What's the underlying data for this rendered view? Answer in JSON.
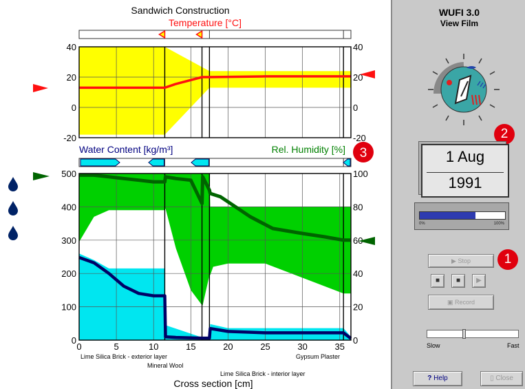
{
  "top_chart": {
    "title": "Sandwich Construction",
    "subtitle": "Temperature [°C]",
    "ylim": [
      -20,
      40
    ],
    "yticks": [
      "40",
      "20",
      "0",
      "-20"
    ],
    "right_yticks": [
      "40",
      "20",
      "0",
      "-20"
    ]
  },
  "bottom_chart": {
    "left_label": "Water Content [kg/m³]",
    "right_label": "Rel. Humidity [%]",
    "yticks_left": [
      "500",
      "400",
      "300",
      "200",
      "100",
      "0"
    ],
    "yticks_right": [
      "100",
      "80",
      "60",
      "40",
      "20",
      "0"
    ],
    "xticks": [
      "0",
      "5",
      "10",
      "15",
      "20",
      "25",
      "30",
      "35"
    ],
    "xlabel": "Cross section [cm]",
    "layer_labels": [
      "Lime Silica Brick - exterior layer",
      "Mineral Wool",
      "Lime Silica Brick - interior layer",
      "Gypsum Plaster"
    ]
  },
  "chart_data": [
    {
      "type": "area",
      "title": "Sandwich Construction",
      "subtitle": "Temperature [°C]",
      "xlim": [
        0,
        36.5
      ],
      "ylim": [
        -20,
        40
      ],
      "layer_boundaries": [
        11.5,
        16.5,
        17.5,
        35.5
      ],
      "series": [
        {
          "name": "Temperature",
          "x": [
            0,
            5,
            11.5,
            13,
            16.5,
            17.5,
            25,
            30,
            35.5,
            36.5
          ],
          "values": [
            13,
            13,
            13,
            15.5,
            20,
            20,
            20.5,
            20.5,
            20.5,
            20.5
          ]
        },
        {
          "name": "Temperature range max",
          "x": [
            0,
            11.5,
            17.5,
            36.5
          ],
          "values": [
            40,
            40,
            24,
            24
          ]
        },
        {
          "name": "Temperature range min",
          "x": [
            0,
            11.5,
            17.5,
            36.5
          ],
          "values": [
            -18,
            -18,
            13,
            13
          ]
        }
      ]
    },
    {
      "type": "area",
      "xlabel": "Cross section [cm]",
      "ylabel": "Water Content [kg/m³]",
      "y2label": "Rel. Humidity [%]",
      "xlim": [
        0,
        36.5
      ],
      "ylim": [
        0,
        500
      ],
      "y2lim": [
        0,
        100
      ],
      "xticks": [
        0,
        5,
        10,
        15,
        20,
        25,
        30,
        35
      ],
      "series": [
        {
          "name": "Rel. Humidity",
          "axis": "right",
          "x": [
            0,
            2,
            4,
            6,
            8,
            10,
            11.5,
            11.6,
            13,
            15,
            16.5,
            16.6,
            17.5,
            17.6,
            19,
            21,
            23,
            26,
            30,
            33,
            35.5,
            36.5
          ],
          "values": [
            99,
            99,
            98,
            97,
            96,
            95,
            95,
            98,
            97,
            96,
            82,
            98,
            90,
            88,
            86,
            80,
            74,
            67,
            64,
            62,
            60,
            60
          ]
        },
        {
          "name": "Rel. Humidity max",
          "axis": "right",
          "x": [
            0,
            11.5,
            11.6,
            16.5,
            16.6,
            17.5,
            17.6,
            35.5,
            36.5
          ],
          "values": [
            100,
            100,
            100,
            100,
            100,
            100,
            80,
            80,
            80
          ]
        },
        {
          "name": "Rel. Humidity min",
          "axis": "right",
          "x": [
            0,
            2,
            4,
            11.5,
            11.6,
            13,
            15,
            16.5,
            16.6,
            17.5,
            17.6,
            18,
            20,
            25,
            35.5,
            36.5
          ],
          "values": [
            59,
            74,
            78,
            78,
            79,
            55,
            30,
            21,
            21,
            39,
            39,
            44,
            46,
            46,
            28,
            28
          ]
        },
        {
          "name": "Water Content",
          "axis": "left",
          "x": [
            0,
            2,
            4,
            6,
            8,
            10,
            11.5,
            11.6,
            13,
            16.5,
            16.6,
            17.5,
            17.6,
            20,
            25,
            30,
            35.5,
            36.5
          ],
          "values": [
            248,
            232,
            200,
            162,
            140,
            133,
            133,
            10,
            8,
            6,
            6,
            6,
            35,
            26,
            22,
            22,
            22,
            5
          ]
        },
        {
          "name": "Water Content max",
          "axis": "left",
          "x": [
            0,
            2,
            4,
            11.5,
            11.6,
            16.5,
            16.6,
            17.5,
            17.6,
            20,
            35.5,
            36.5
          ],
          "values": [
            260,
            240,
            215,
            215,
            45,
            8,
            8,
            8,
            48,
            36,
            36,
            10
          ]
        }
      ]
    }
  ],
  "side_panel": {
    "app_title": "WUFI 3.0",
    "view_title": "View Film",
    "date_day": "1 Aug",
    "date_year": "1991",
    "progress_min": "0%",
    "progress_max": "100%",
    "progress_fraction": 0.65,
    "stop_label": "Stop",
    "record_label": "Record",
    "speed_slow": "Slow",
    "speed_fast": "Fast",
    "speed_fraction": 0.4,
    "help_label": "Help",
    "close_label": "Close",
    "markers": [
      "1",
      "2",
      "3"
    ]
  },
  "colors": {
    "temp_band": "#ffff00",
    "temp_line": "#ff1010",
    "rh_band": "#00d000",
    "rh_line": "#006400",
    "wc_band": "#00e6f0",
    "wc_line": "#000066",
    "marker": "#e0000e",
    "water_text": "#000080",
    "rh_text": "#008000",
    "drop": "#002266"
  },
  "icons": [
    "play-icon",
    "clock-icon",
    "water-drop-icon",
    "help-icon",
    "close-icon",
    "triangle-marker-icon"
  ]
}
